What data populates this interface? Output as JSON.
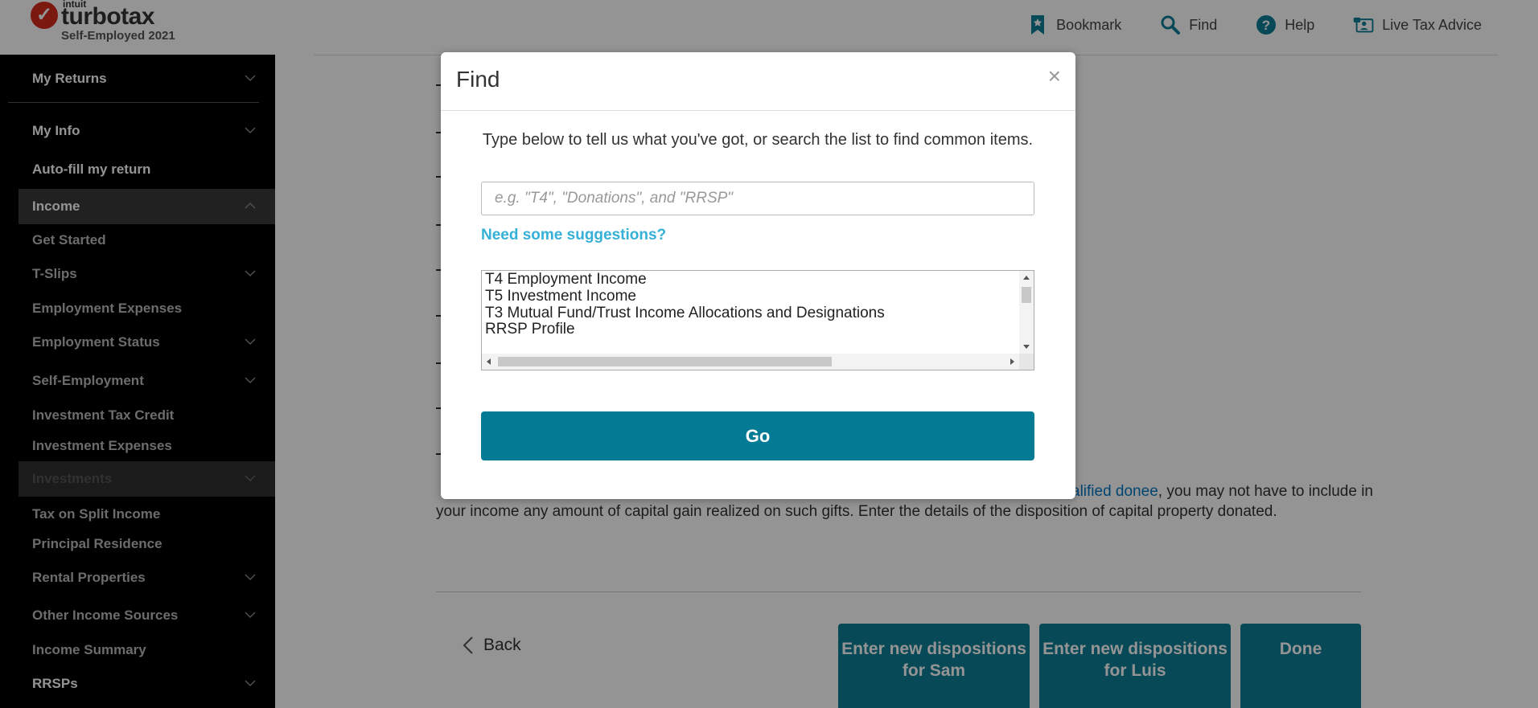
{
  "header": {
    "brand_small": "intuit",
    "brand": "turbotax",
    "edition": "Self-Employed 2021",
    "nav": [
      {
        "label": "Bookmark",
        "icon": "bookmark-icon"
      },
      {
        "label": "Find",
        "icon": "search-icon"
      },
      {
        "label": "Help",
        "icon": "help-icon"
      },
      {
        "label": "Live Tax Advice",
        "icon": "live-advice-icon"
      }
    ]
  },
  "sidebar": {
    "items": [
      {
        "label": "My Returns"
      },
      {
        "label": "My Info"
      },
      {
        "label": "Auto-fill my return"
      },
      {
        "label": "Income"
      },
      {
        "label": "Get Started"
      },
      {
        "label": "T-Slips"
      },
      {
        "label": "Employment Expenses"
      },
      {
        "label": "Employment Status"
      },
      {
        "label": "Self-Employment"
      },
      {
        "label": "Investment Tax Credit"
      },
      {
        "label": "Investment Expenses"
      },
      {
        "label": "Investments"
      },
      {
        "label": "Tax on Split Income"
      },
      {
        "label": "Principal Residence"
      },
      {
        "label": "Rental Properties"
      },
      {
        "label": "Other Income Sources"
      },
      {
        "label": "Income Summary"
      },
      {
        "label": "RRSPs"
      }
    ]
  },
  "main": {
    "body_link": "alified donee",
    "body_rest": ", you may not have to include in your income any amount of capital gain realized on such gifts. Enter the details of the disposition of capital property donated.",
    "back_label": "Back",
    "btn_sam": "Enter new dispositions for Sam",
    "btn_luis": "Enter new dispositions for Luis",
    "btn_done": "Done"
  },
  "modal": {
    "title": "Find",
    "close": "×",
    "instructions": "Type below to tell us what you've got, or search the list to find common items.",
    "search_placeholder": "e.g. \"T4\", \"Donations\", and \"RRSP\"",
    "suggest_link": "Need some suggestions?",
    "list": [
      "T4 Employment Income",
      "T5 Investment Income",
      "T3 Mutual Fund/Trust Income Allocations and Designations",
      "RRSP Profile"
    ],
    "go_label": "Go"
  }
}
